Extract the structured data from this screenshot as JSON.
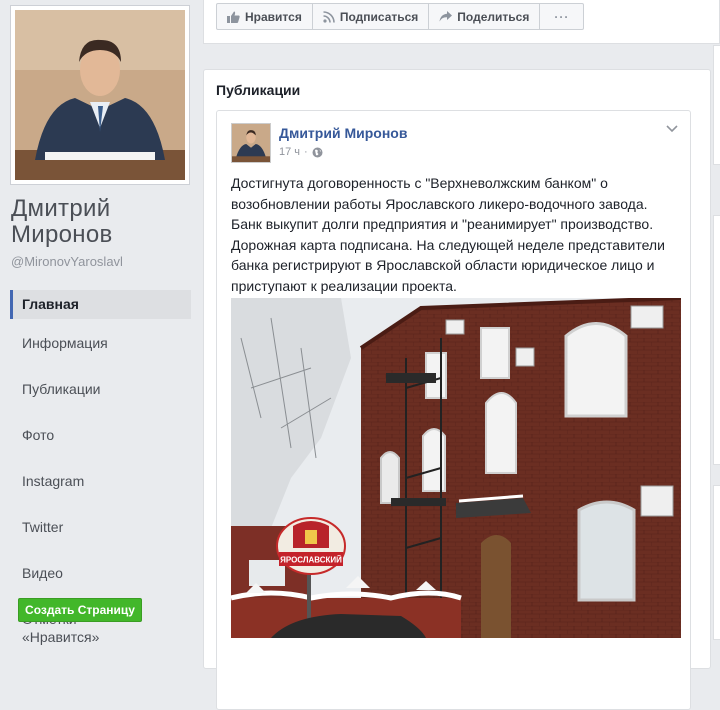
{
  "profile": {
    "name": "Дмитрий Миронов",
    "handle": "@MironovYaroslavl"
  },
  "nav": {
    "items": [
      {
        "label": "Главная"
      },
      {
        "label": "Информация"
      },
      {
        "label": "Публикации"
      },
      {
        "label": "Фото"
      },
      {
        "label": "Instagram"
      },
      {
        "label": "Twitter"
      },
      {
        "label": "Видео"
      },
      {
        "label": "Отметки «Нравится»"
      }
    ],
    "create_page": "Создать Страницу"
  },
  "actions": {
    "like": "Нравится",
    "subscribe": "Подписаться",
    "share": "Поделиться",
    "more": "···"
  },
  "publications": {
    "title": "Публикации",
    "post": {
      "author": "Дмитрий Миронов",
      "time": "17 ч",
      "separator": "·",
      "text": "Достигнута договоренность с \"Верхневолжским банком\" о возобновлении работы Ярославского ликеро-водочного завода. Банк выкупит долги предприятия и \"реанимирует\" производство. Дорожная карта подписана. На следующей неделе представители банка регистрируют в Ярославской области юридическое лицо и приступают к реализации проекта.",
      "image_sign": "ЯРОСЛАВСКИЙ"
    }
  },
  "colors": {
    "accent": "#4267b2",
    "link": "#365899",
    "green": "#42b72a",
    "background": "#e9ebee"
  }
}
